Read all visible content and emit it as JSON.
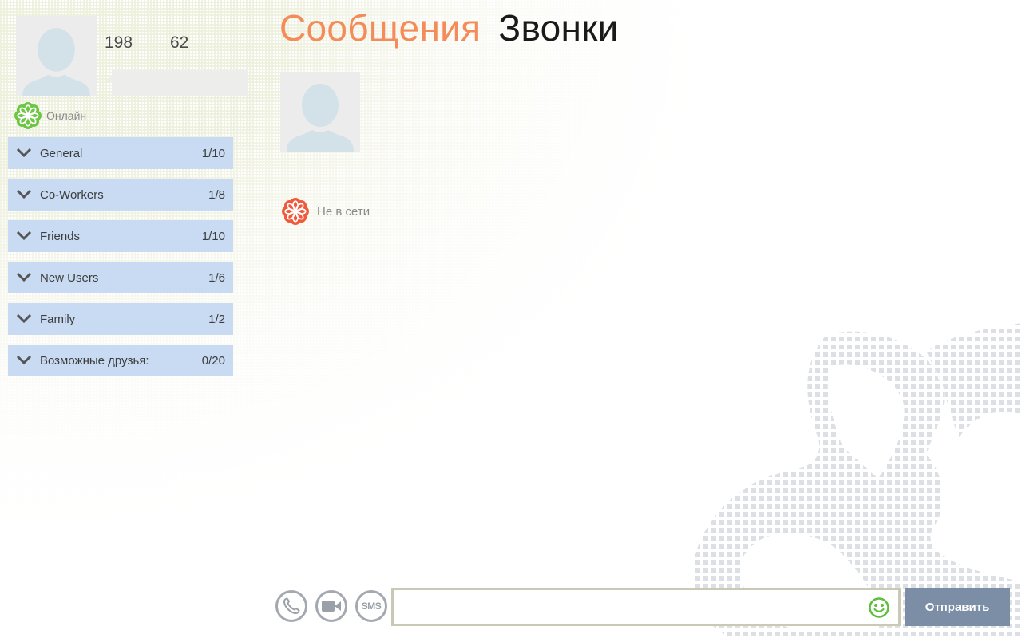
{
  "profile": {
    "stats": [
      "198",
      "62"
    ],
    "status_message": "",
    "presence": "Онлайн",
    "presence_color": "#6cc644"
  },
  "groups": [
    {
      "name": "General",
      "count": "1/10"
    },
    {
      "name": "Co-Workers",
      "count": "1/8"
    },
    {
      "name": "Friends",
      "count": "1/10"
    },
    {
      "name": "New Users",
      "count": "1/6"
    },
    {
      "name": "Family",
      "count": "1/2"
    },
    {
      "name": "Возможные друзья:",
      "count": "0/20"
    }
  ],
  "tabs": {
    "messages": "Сообщения",
    "calls": "Звонки",
    "active": "messages",
    "active_color": "#f48c5a"
  },
  "contact": {
    "presence": "Не в сети",
    "presence_color": "#f05a3a"
  },
  "composer": {
    "call_icon": "phone-icon",
    "video_icon": "video-camera-icon",
    "sms_label": "SMS",
    "input_value": "",
    "input_placeholder": "",
    "emoji_icon": "smiley-icon",
    "send_label": "Отправить",
    "send_color": "#7c8ea5"
  }
}
